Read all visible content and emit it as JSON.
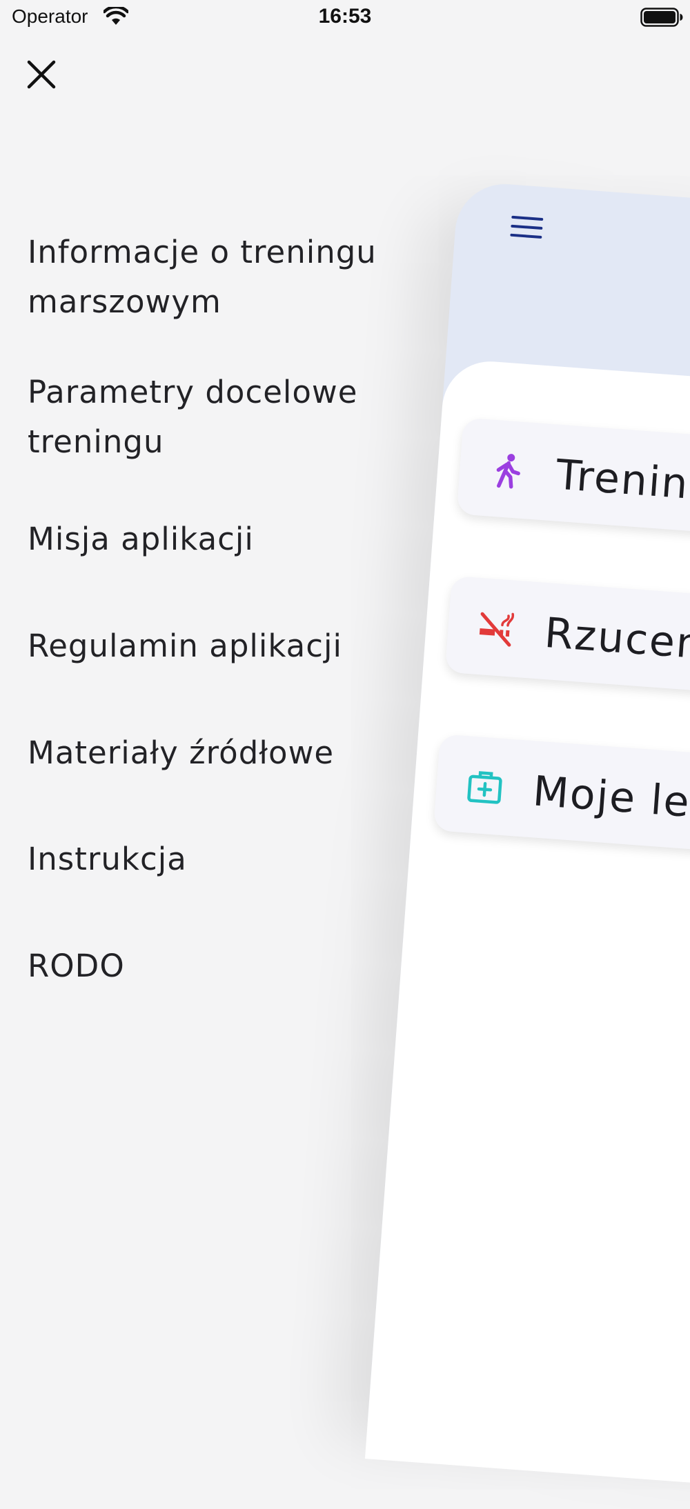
{
  "status_bar": {
    "carrier": "Operator",
    "time": "16:53"
  },
  "drawer": {
    "close_icon": "close-icon",
    "items": [
      {
        "label_line1": "Informacje o treningu",
        "label_line2": "marszowym"
      },
      {
        "label_line1": "Parametry docelowe",
        "label_line2": "treningu"
      },
      {
        "label": "Misja aplikacji"
      },
      {
        "label": "Regulamin aplikacji"
      },
      {
        "label": "Materiały źródłowe"
      },
      {
        "label": "Instrukcja"
      },
      {
        "label": "RODO"
      }
    ]
  },
  "main_preview": {
    "menu_icon": "hamburger-menu-icon",
    "header_color": "#e2e8f5",
    "cards": [
      {
        "label": "Trenin",
        "icon": "walking-person-icon",
        "icon_color": "#9b3fe0"
      },
      {
        "label": "Rzucen",
        "icon": "no-smoking-icon",
        "icon_color": "#e23a3a"
      },
      {
        "label": "Moje lek",
        "icon": "first-aid-kit-icon",
        "icon_color": "#22c2c2"
      }
    ]
  }
}
